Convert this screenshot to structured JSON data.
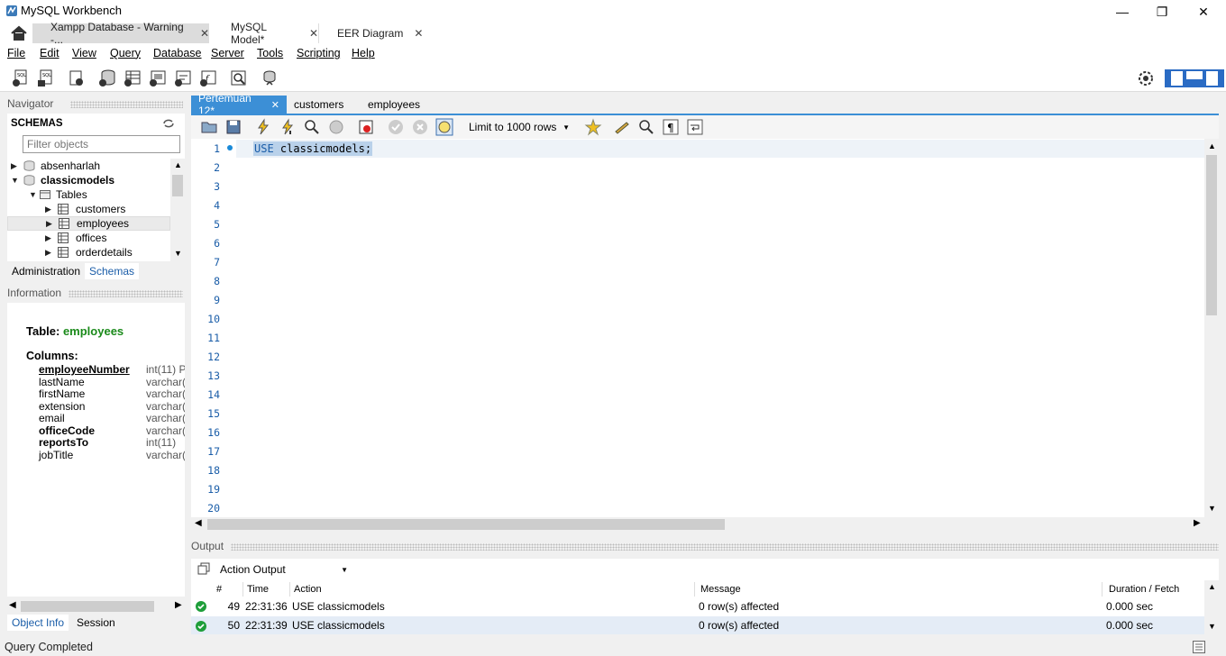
{
  "window": {
    "title": "MySQL Workbench",
    "minimize": "—",
    "maximize": "❐",
    "close": "✕"
  },
  "tabs": [
    {
      "label": "Xampp Database - Warning -...",
      "close": "✕"
    },
    {
      "label": "MySQL Model*",
      "close": "✕"
    },
    {
      "label": "EER Diagram",
      "close": "✕"
    }
  ],
  "menu": [
    "File",
    "Edit",
    "View",
    "Query",
    "Database",
    "Server",
    "Tools",
    "Scripting",
    "Help"
  ],
  "navigator": {
    "title": "Navigator",
    "schemas_title": "SCHEMAS",
    "filter_placeholder": "Filter objects",
    "tree": {
      "schema1": "absenharlah",
      "schema2": "classicmodels",
      "tables": "Tables",
      "t1": "customers",
      "t2": "employees",
      "t3": "offices",
      "t4": "orderdetails"
    },
    "tab_admin": "Administration",
    "tab_schemas": "Schemas"
  },
  "information": {
    "title": "Information",
    "table_label": "Table:",
    "table_name": "employees",
    "columns_label": "Columns:",
    "columns": [
      {
        "name": "employeeNumber",
        "type": "int(11) P"
      },
      {
        "name": "lastName",
        "type": "varchar("
      },
      {
        "name": "firstName",
        "type": "varchar("
      },
      {
        "name": "extension",
        "type": "varchar("
      },
      {
        "name": "email",
        "type": "varchar("
      },
      {
        "name": "officeCode",
        "type": "varchar("
      },
      {
        "name": "reportsTo",
        "type": "int(11)"
      },
      {
        "name": "jobTitle",
        "type": "varchar("
      }
    ],
    "tab_object": "Object Info",
    "tab_session": "Session"
  },
  "editor": {
    "tabs": [
      {
        "label": "Pertemuan 12*",
        "close": "✕"
      },
      {
        "label": "customers"
      },
      {
        "label": "employees"
      }
    ],
    "limit": "Limit to 1000 rows",
    "line_numbers": [
      "1",
      "2",
      "3",
      "4",
      "5",
      "6",
      "7",
      "8",
      "9",
      "10",
      "11",
      "12",
      "13",
      "14",
      "15",
      "16",
      "17",
      "18",
      "19",
      "20"
    ],
    "code_keyword": "USE",
    "code_rest": " classicmodels;"
  },
  "output": {
    "title": "Output",
    "select": "Action Output",
    "headers": {
      "num": "#",
      "time": "Time",
      "action": "Action",
      "message": "Message",
      "duration": "Duration / Fetch"
    },
    "rows": [
      {
        "num": "49",
        "time": "22:31:36",
        "action": "USE classicmodels",
        "message": "0 row(s) affected",
        "duration": "0.000 sec"
      },
      {
        "num": "50",
        "time": "22:31:39",
        "action": "USE classicmodels",
        "message": "0 row(s) affected",
        "duration": "0.000 sec"
      }
    ]
  },
  "status": "Query Completed",
  "colors": {
    "accent": "#3c8fd6",
    "table_name": "#1a8a1a",
    "ok": "#1e9e3a"
  }
}
